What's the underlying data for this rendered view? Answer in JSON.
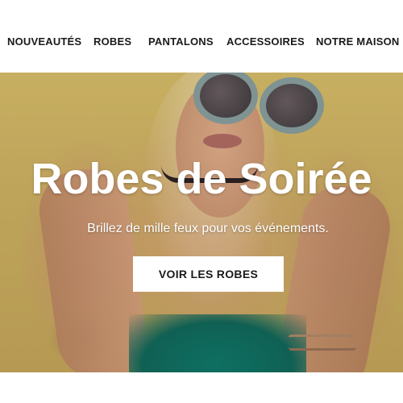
{
  "nav": {
    "items": [
      {
        "label": "NOUVEAUTÉS"
      },
      {
        "label": "ROBES"
      },
      {
        "label": "PANTALONS"
      },
      {
        "label": "ACCESSOIRES"
      },
      {
        "label": "NOTRE MAISON"
      }
    ]
  },
  "hero": {
    "title": "Robes de Soirée",
    "subtitle": "Brillez de mille feux pour vos événements.",
    "cta_label": "VOIR LES ROBES"
  },
  "colors": {
    "nav_text": "#1a1a1a",
    "hero_text": "#ffffff",
    "cta_background": "#ffffff",
    "cta_text": "#1a1a1a"
  }
}
